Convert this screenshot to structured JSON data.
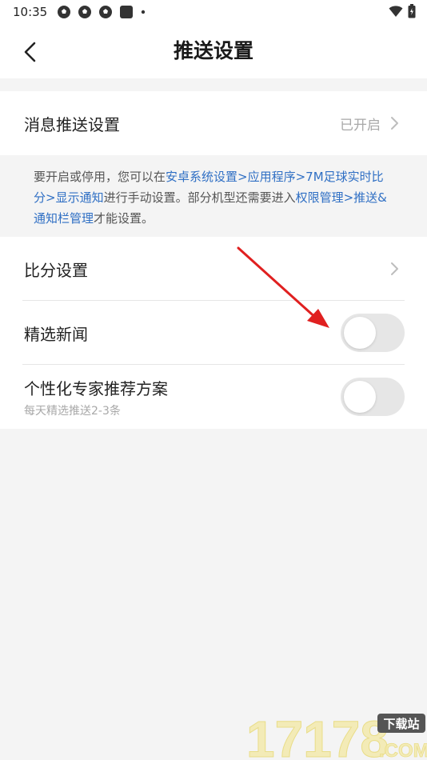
{
  "status_bar": {
    "time": "10:35"
  },
  "header": {
    "title": "推送设置"
  },
  "push_settings_row": {
    "label": "消息推送设置",
    "value": "已开启"
  },
  "notice": {
    "text_1": "要开启或停用，您可以在",
    "link_1": "安卓系统设置>应用程序>7M足球实时比分>显示通知",
    "text_2": "进行手动设置。部分机型还需要进入",
    "link_2": "权限管理>推送&通知栏管理",
    "text_3": "才能设置。"
  },
  "settings": {
    "score_label": "比分设置",
    "news_label": "精选新闻",
    "news_enabled": false,
    "expert_label": "个性化专家推荐方案",
    "expert_sub": "每天精选推送2-3条",
    "expert_enabled": false
  },
  "watermark": {
    "number": "17178",
    "badge": "下载站",
    "domain": ".COM"
  },
  "colors": {
    "accent_link": "#2f6fc4",
    "background": "#f4f4f4",
    "toggle_off": "#e6e6e6",
    "arrow": "#e02020"
  }
}
